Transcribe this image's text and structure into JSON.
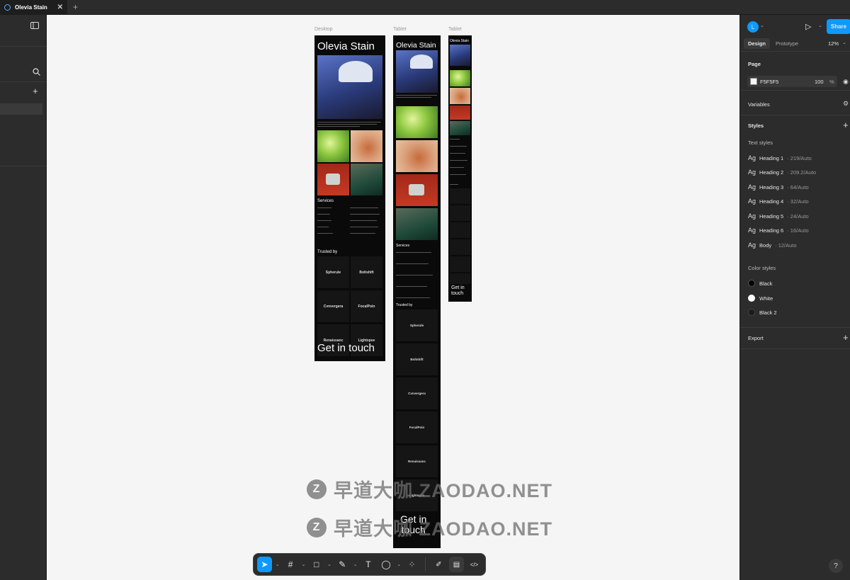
{
  "tab": {
    "title": "Olevia Stain",
    "close": "✕",
    "new": "+"
  },
  "frames": {
    "desktop_label": "Desktop",
    "tablet_label": "Tablet",
    "mobile_label": "Tablet",
    "site_title": "Olevia Stain",
    "services": "Services",
    "trusted_by": "Trusted by",
    "get_in_touch": "Get in touch",
    "get_in": "Get in",
    "touch": "touch",
    "logos": [
      "Spherule",
      "Boltshift",
      "Cvnvergera",
      "FocalPoin",
      "Renaissanc",
      "Lightspee"
    ]
  },
  "right_panel": {
    "avatar_letter": "L",
    "share_label": "Share",
    "tabs": [
      "Design",
      "Prototype"
    ],
    "zoom": "12%",
    "page_heading": "Page",
    "page_color": "F5F5F5",
    "page_opacity": "100",
    "page_opacity_unit": "%",
    "variables": "Variables",
    "styles": "Styles",
    "text_styles_heading": "Text styles",
    "text_styles": [
      {
        "name": "Heading 1",
        "meta": "· 219/Auto"
      },
      {
        "name": "Heading 2",
        "meta": "· 209.2/Auto"
      },
      {
        "name": "Heading 3",
        "meta": "· 64/Auto"
      },
      {
        "name": "Heading 4",
        "meta": "· 32/Auto"
      },
      {
        "name": "Heading 5",
        "meta": "· 24/Auto"
      },
      {
        "name": "Heading 6",
        "meta": "· 16/Auto"
      },
      {
        "name": "Body",
        "meta": "· 12/Auto"
      }
    ],
    "ag": "Ag",
    "color_styles_heading": "Color styles",
    "color_styles": [
      {
        "name": "Black",
        "color": "#000000"
      },
      {
        "name": "White",
        "color": "#ffffff"
      },
      {
        "name": "Black 2",
        "color": "#1a1a1a"
      }
    ],
    "export": "Export"
  },
  "toolbar": {
    "move": "➤",
    "frame": "#",
    "shape": "□",
    "pen": "✎",
    "text": "T",
    "comment": "◯",
    "actions": "⁘",
    "dev1": "✐",
    "dev2": "▤",
    "dev3": "</>",
    "chev": "⌄"
  },
  "watermark": {
    "logo": "Z",
    "text": "早道大咖 ZAODAO.NET"
  },
  "help": "?",
  "colors": {
    "accent": "#0d99ff",
    "canvas": "#F5F5F5",
    "chrome": "#2c2c2c"
  }
}
